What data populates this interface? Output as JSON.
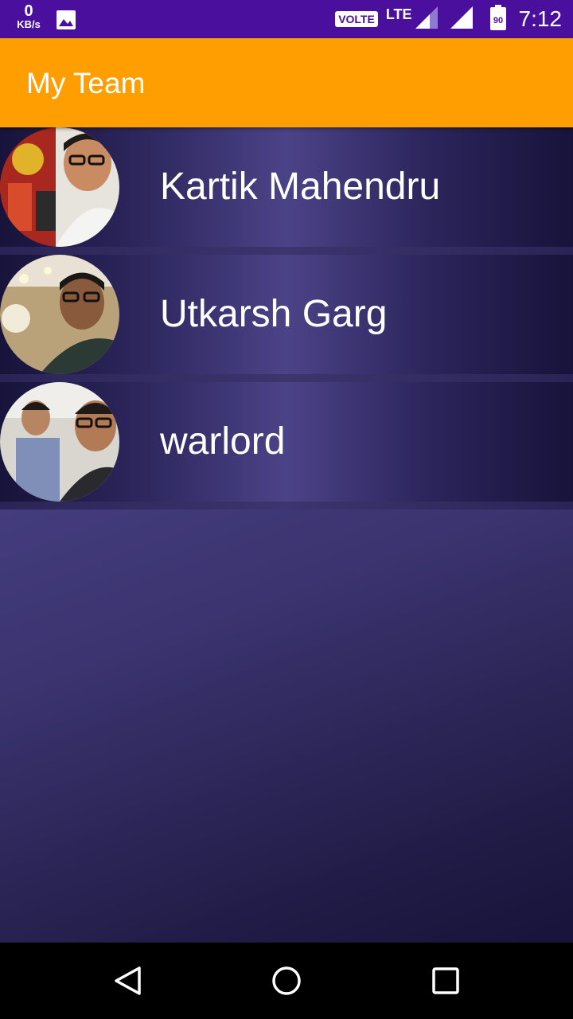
{
  "status_bar": {
    "net_speed_value": "0",
    "net_speed_unit": "KB/s",
    "volte_label": "VOLTE",
    "lte_label": "LTE",
    "battery_level": "90",
    "time": "7:12",
    "icons": [
      "gallery-icon",
      "signal-icon",
      "battery-icon"
    ]
  },
  "app_bar": {
    "title": "My Team"
  },
  "team": {
    "members": [
      {
        "name": "Kartik Mahendru"
      },
      {
        "name": "Utkarsh Garg"
      },
      {
        "name": "warlord"
      }
    ]
  },
  "nav_bar": {
    "icons": [
      "back-icon",
      "home-icon",
      "recents-icon"
    ]
  },
  "colors": {
    "status_bar": "#4a0f9c",
    "app_bar": "#ff9e00",
    "background_dark": "#17133a",
    "background_light": "#4a4286",
    "text": "#ffffff"
  }
}
